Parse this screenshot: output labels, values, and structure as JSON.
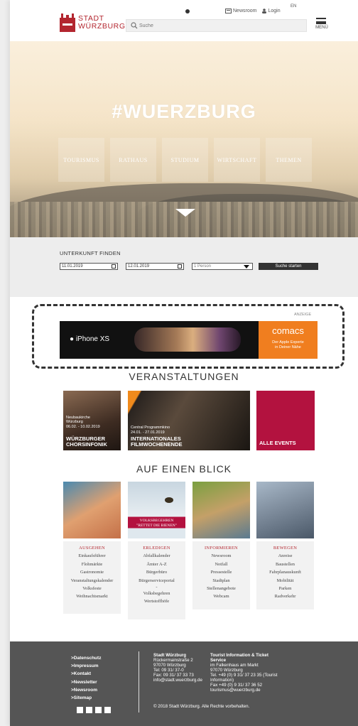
{
  "header": {
    "logo_line1": "STADT",
    "logo_line2": "WÜRZBURG",
    "search_placeholder": "Suche",
    "newsroom": "Newsroom",
    "login": "Login",
    "lang": "EN",
    "menu": "MENÜ"
  },
  "hero": {
    "title": "#WUERZBURG",
    "nav": [
      "TOURISMUS",
      "RATHAUS",
      "STUDIUM",
      "WIRTSCHAFT",
      "THEMEN"
    ]
  },
  "booking": {
    "title": "UNTERKUNFT FINDEN",
    "date_from": "11.01.2019",
    "date_to": "12.01.2019",
    "persons": "1 Person",
    "button": "Suche starten"
  },
  "ad": {
    "label": "ANZEIGE",
    "product": "iPhone XS",
    "brand": "comacs",
    "tagline1": "Der Apple Experte",
    "tagline2": "in Deiner Nähe"
  },
  "events": {
    "title": "VERANSTALTUNGEN",
    "items": [
      {
        "meta1": "Neubaukirche",
        "meta2": "Würzburg",
        "date": "06.02. - 10.02.2019",
        "name1": "WÜRZBURGER",
        "name2": "CHORSINFONIK"
      },
      {
        "meta1": "Central Programmkino",
        "date": "24.01. - 27.01.2019",
        "name1": "INTERNATIONALES",
        "name2": "FILMWOCHENENDE"
      },
      {
        "name1": "ALLE EVENTS"
      }
    ]
  },
  "glance": {
    "title": "AUF EINEN BLICK",
    "banner": "VOLKSBEGEHREN\n\"RETTET DIE BIENEN\"",
    "columns": [
      {
        "head": "AUSGEHEN",
        "items": [
          "Einkaufsführer",
          "Flohmärkte",
          "Gastronomie",
          "Veranstaltungskalender",
          "Volksfeste",
          "Weihnachtsmarkt"
        ]
      },
      {
        "head": "ERLEDIGEN",
        "items": [
          "Abfallkalender",
          "Ämter A-Z",
          "Bürgerbüro",
          "Bürgerserviceportal",
          "-",
          "Volksbegehren",
          "Wertstoffhöfe"
        ]
      },
      {
        "head": "INFORMIEREN",
        "items": [
          "Newsroom",
          "Notfall",
          "Pressestelle",
          "Stadtplan",
          "Stellenangebote",
          "Webcam"
        ]
      },
      {
        "head": "BEWEGEN",
        "items": [
          "Anreise",
          "Baustellen",
          "Fahrplanauskunft",
          "Mobilität",
          "Parken",
          "Radverkehr"
        ]
      }
    ]
  },
  "footer": {
    "links": [
      ">Datenschutz",
      ">Impressum",
      ">Kontakt",
      ">Newsletter",
      ">Newsroom",
      ">Sitemap"
    ],
    "col1": [
      "Stadt Würzburg",
      "Rückermainstraße 2",
      "97070 Würzburg",
      "Tel: 09 31/ 37-0",
      "Fax: 09 31/ 37 33 73",
      "info@stadt.wuerzburg.de"
    ],
    "col2": [
      "Tourist Information & Ticket",
      "Service",
      "im Falkenhaus am Markt",
      "97070 Würzburg",
      "Tel. +49 (0) 9 31/ 37 23 35 (Tourist",
      "Information)",
      "Fax +49 (0) 9 31/ 37 36 52",
      "tourismus@wuerzburg.de"
    ],
    "copyright": "© 2018 Stadt Würzburg. Alle Rechte vorbehalten."
  }
}
